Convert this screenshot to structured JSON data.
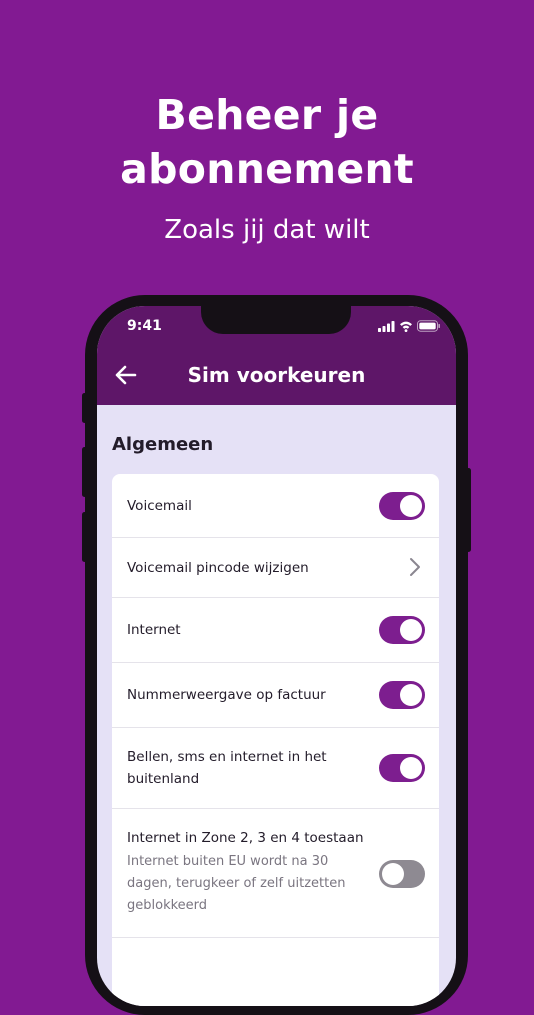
{
  "hero": {
    "title_line1": "Beheer je",
    "title_line2": "abonnement",
    "subtitle": "Zoals jij dat wilt"
  },
  "status_bar": {
    "time": "9:41",
    "icons": [
      "signal-icon",
      "wifi-icon",
      "battery-icon"
    ]
  },
  "app_bar": {
    "title": "Sim voorkeuren",
    "back_icon": "arrow-left-icon"
  },
  "section": {
    "title": "Algemeen"
  },
  "settings": [
    {
      "label": "Voicemail",
      "control": "toggle",
      "on": true
    },
    {
      "label": "Voicemail pincode wijzigen",
      "control": "chevron"
    },
    {
      "label": "Internet",
      "control": "toggle",
      "on": true
    },
    {
      "label": "Nummerweergave op factuur",
      "control": "toggle",
      "on": true
    },
    {
      "label_line1": "Bellen, sms en internet in het",
      "label_line2": "buitenland",
      "control": "toggle",
      "on": true
    },
    {
      "label": "Internet in Zone 2, 3 en 4 toestaan",
      "description_line1": "Internet buiten EU wordt na 30",
      "description_line2": "dagen, terugkeer of zelf uitzetten",
      "description_line3": "geblokkeerd",
      "control": "toggle",
      "on": false
    }
  ],
  "colors": {
    "background": "#821a92",
    "app_bar": "#5e1668",
    "screen_background": "#e5e1f6",
    "toggle_on": "#7d1e8f",
    "toggle_off": "#8e8a92"
  }
}
